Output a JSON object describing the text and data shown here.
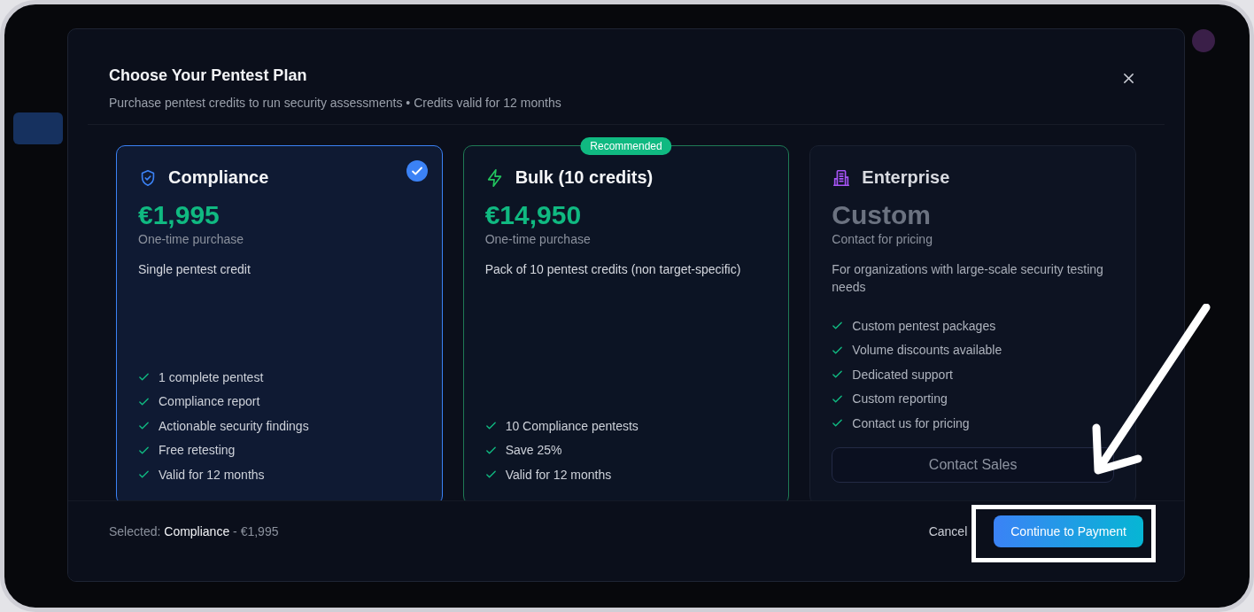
{
  "dialog": {
    "title": "Choose Your Pentest Plan",
    "subtitle": "Purchase pentest credits to run security assessments • Credits valid for 12 months"
  },
  "plans": [
    {
      "kind": "single",
      "name": "Compliance",
      "price": "€1,995",
      "price_note": "One-time purchase",
      "description": "Single pentest credit",
      "selected": true,
      "recommended": false,
      "features": [
        "1 complete pentest",
        "Compliance report",
        "Actionable security findings",
        "Free retesting",
        "Valid for 12 months"
      ]
    },
    {
      "kind": "bulk",
      "name": "Bulk (10 credits)",
      "price": "€14,950",
      "price_note": "One-time purchase",
      "description": "Pack of 10 pentest credits (non target-specific)",
      "selected": false,
      "recommended": true,
      "badge": "Recommended",
      "features": [
        "10 Compliance pentests",
        "Save 25%",
        "Valid for 12 months"
      ]
    },
    {
      "kind": "custom",
      "name": "Enterprise",
      "price": "Custom",
      "price_note": "Contact for pricing",
      "description": "For organizations with large-scale security testing needs",
      "selected": false,
      "recommended": false,
      "features": [
        "Custom pentest packages",
        "Volume discounts available",
        "Dedicated support",
        "Custom reporting",
        "Contact us for pricing"
      ],
      "button": "Contact Sales"
    }
  ],
  "footer": {
    "summary": "Selected: **Compliance** - €1,995",
    "cancel": "Cancel",
    "continue": "Continue to Payment"
  }
}
